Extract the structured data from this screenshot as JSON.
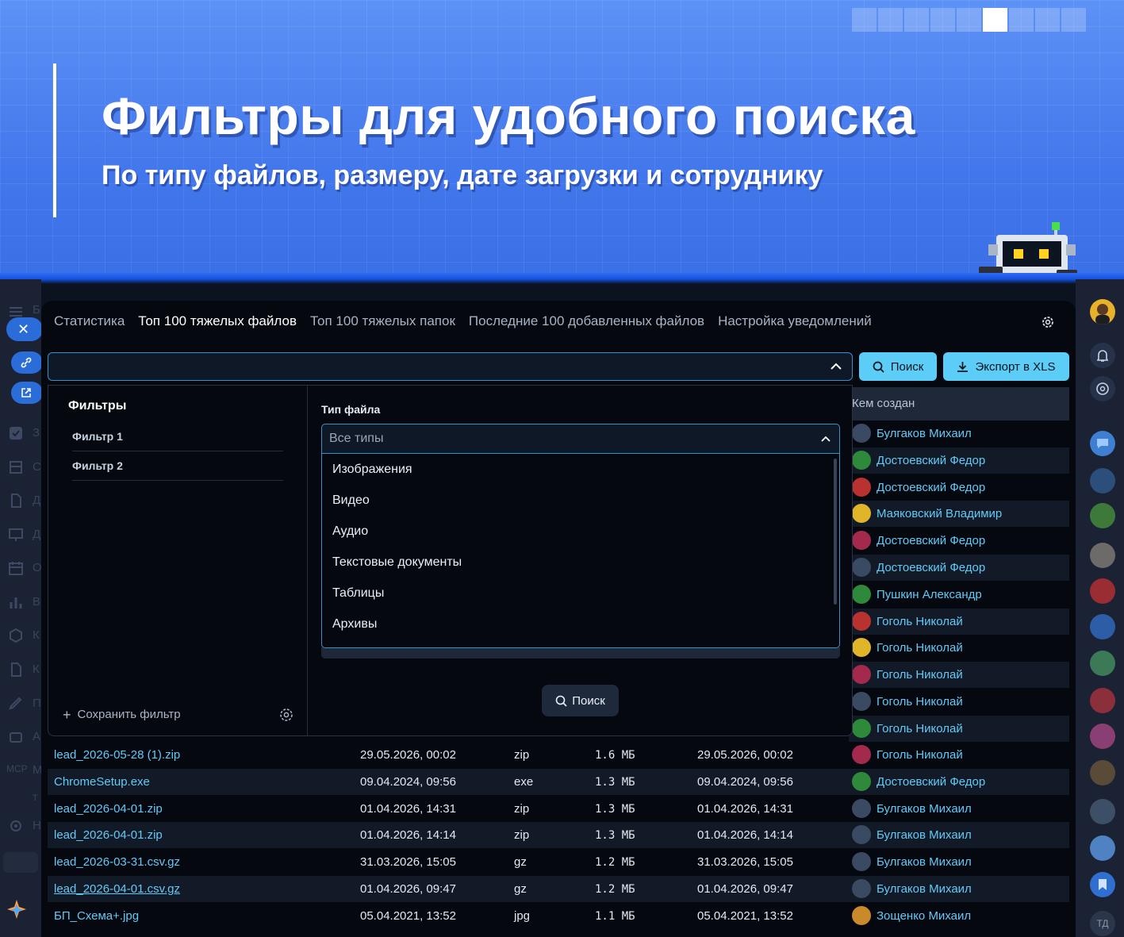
{
  "banner": {
    "title": "Фильтры для удобного поиска",
    "subtitle": "По типу файлов, размеру, дате загрузки и сотруднику",
    "slides_total": 9,
    "active_slide": 6
  },
  "tabs": [
    {
      "label": "Статистика",
      "active": false
    },
    {
      "label": "Топ 100 тяжелых файлов",
      "active": true
    },
    {
      "label": "Топ 100 тяжелых папок",
      "active": false
    },
    {
      "label": "Последние 100 добавленных файлов",
      "active": false
    },
    {
      "label": "Настройка уведомлений",
      "active": false
    }
  ],
  "toolbar": {
    "search_value": "",
    "search_label": "Поиск",
    "export_label": "Экспорт в XLS"
  },
  "filters": {
    "title": "Фильтры",
    "items": [
      "Фильтр 1",
      "Фильтр 2"
    ],
    "save_label": "Сохранить фильтр",
    "file_type_label": "Тип файла",
    "file_type_selected": "Все типы",
    "file_type_options": [
      "Изображения",
      "Видео",
      "Аудио",
      "Текстовые документы",
      "Таблицы",
      "Архивы"
    ],
    "search_label": "Поиск"
  },
  "table": {
    "created_by_header": "Кем создан",
    "hidden_rows_users": [
      "Булгаков Михаил",
      "Достоевский Федор",
      "Достоевский Федор",
      "Маяковский Владимир",
      "Достоевский Федор",
      "Достоевский Федор",
      "Пушкин Александр",
      "Гоголь Николай",
      "Гоголь Николай",
      "Гоголь Николай",
      "Гоголь Николай",
      "Гоголь Николай"
    ],
    "rows": [
      {
        "name": "lead_2026-05-28 (1).zip",
        "date": "29.05.2026, 00:02",
        "ext": "zip",
        "size": "1.6 МБ",
        "date2": "29.05.2026, 00:02",
        "user": "Гоголь Николай"
      },
      {
        "name": "ChromeSetup.exe",
        "date": "09.04.2024, 09:56",
        "ext": "exe",
        "size": "1.3 МБ",
        "date2": "09.04.2024, 09:56",
        "user": "Достоевский Федор"
      },
      {
        "name": "lead_2026-04-01.zip",
        "date": "01.04.2026, 14:31",
        "ext": "zip",
        "size": "1.3 МБ",
        "date2": "01.04.2026, 14:31",
        "user": "Булгаков Михаил"
      },
      {
        "name": "lead_2026-04-01.zip",
        "date": "01.04.2026, 14:14",
        "ext": "zip",
        "size": "1.3 МБ",
        "date2": "01.04.2026, 14:14",
        "user": "Булгаков Михаил"
      },
      {
        "name": "lead_2026-03-31.csv.gz",
        "date": "31.03.2026, 15:05",
        "ext": "gz",
        "size": "1.2 МБ",
        "date2": "31.03.2026, 15:05",
        "user": "Булгаков Михаил"
      },
      {
        "name": "lead_2026-04-01.csv.gz",
        "date": "01.04.2026, 09:47",
        "ext": "gz",
        "size": "1.2 МБ",
        "date2": "01.04.2026, 09:47",
        "user": "Булгаков Михаил"
      },
      {
        "name": "БП_Схема+.jpg",
        "date": "05.04.2021, 13:52",
        "ext": "jpg",
        "size": "1.1 МБ",
        "date2": "05.04.2021, 13:52",
        "user": "Зощенко Михаил"
      }
    ]
  },
  "sidebar": {
    "letters": [
      "Б",
      "З",
      "С",
      "Д",
      "Д",
      "О",
      "В",
      "К",
      "К",
      "П",
      "А",
      "M",
      "Т",
      "Н"
    ],
    "mcp_label": "MCP"
  },
  "rail": {
    "initials": "ТД"
  },
  "colors": {
    "accent": "#5ccdf6",
    "link": "#63c9f7",
    "panel_bg": "#05080f",
    "banner_blue": "#4a7ff0"
  }
}
